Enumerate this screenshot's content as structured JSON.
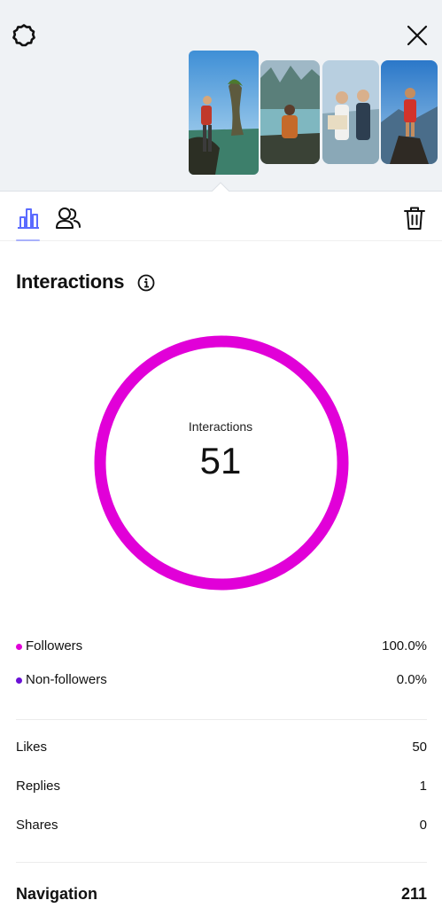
{
  "header": {
    "settings_icon": "gear-icon",
    "close_icon": "close-icon",
    "thumbnails": [
      {
        "icon": "photo-thumbnail",
        "selected": true
      },
      {
        "icon": "photo-thumbnail",
        "selected": false
      },
      {
        "icon": "photo-thumbnail",
        "selected": false
      },
      {
        "icon": "photo-thumbnail",
        "selected": false
      }
    ]
  },
  "tabs": {
    "stats_icon": "bar-chart-icon",
    "audience_icon": "people-icon",
    "delete_icon": "trash-icon",
    "accent_color": "#5b6bff"
  },
  "interactions": {
    "title": "Interactions",
    "donut_label": "Interactions",
    "donut_value": "51",
    "ring_color": "#e100d8"
  },
  "chart_data": {
    "type": "pie",
    "title": "Interactions",
    "series": [
      {
        "name": "Followers",
        "value": 100.0,
        "color": "#e100d8"
      },
      {
        "name": "Non-followers",
        "value": 0.0,
        "color": "#6a10d6"
      }
    ],
    "total": 51
  },
  "legend": [
    {
      "label": "Followers",
      "value": "100.0%",
      "color": "#e100d8"
    },
    {
      "label": "Non-followers",
      "value": "0.0%",
      "color": "#6a10d6"
    }
  ],
  "metrics": [
    {
      "label": "Likes",
      "value": "50"
    },
    {
      "label": "Replies",
      "value": "1"
    },
    {
      "label": "Shares",
      "value": "0"
    }
  ],
  "navigation": {
    "label": "Navigation",
    "value": "211"
  }
}
